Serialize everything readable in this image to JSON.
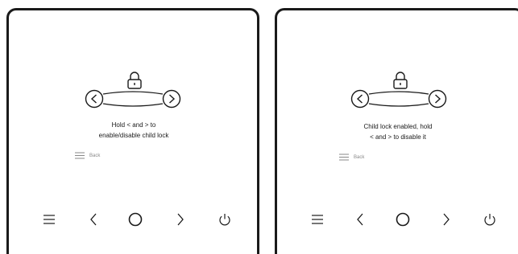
{
  "screens": [
    {
      "instruction_line1": "Hold  < and  > to",
      "instruction_line2": "enable/disable child lock",
      "back_label": "Back"
    },
    {
      "instruction_line1": "Child lock enabled,   hold",
      "instruction_line2": "< and  > to disable it",
      "back_label": "Back"
    }
  ],
  "nav_buttons": [
    "menu-icon",
    "chevron-left-icon",
    "home-circle-icon",
    "chevron-right-icon",
    "power-icon"
  ],
  "colors": {
    "stroke": "#1a1a1a",
    "muted": "#888888",
    "background": "#ffffff"
  }
}
